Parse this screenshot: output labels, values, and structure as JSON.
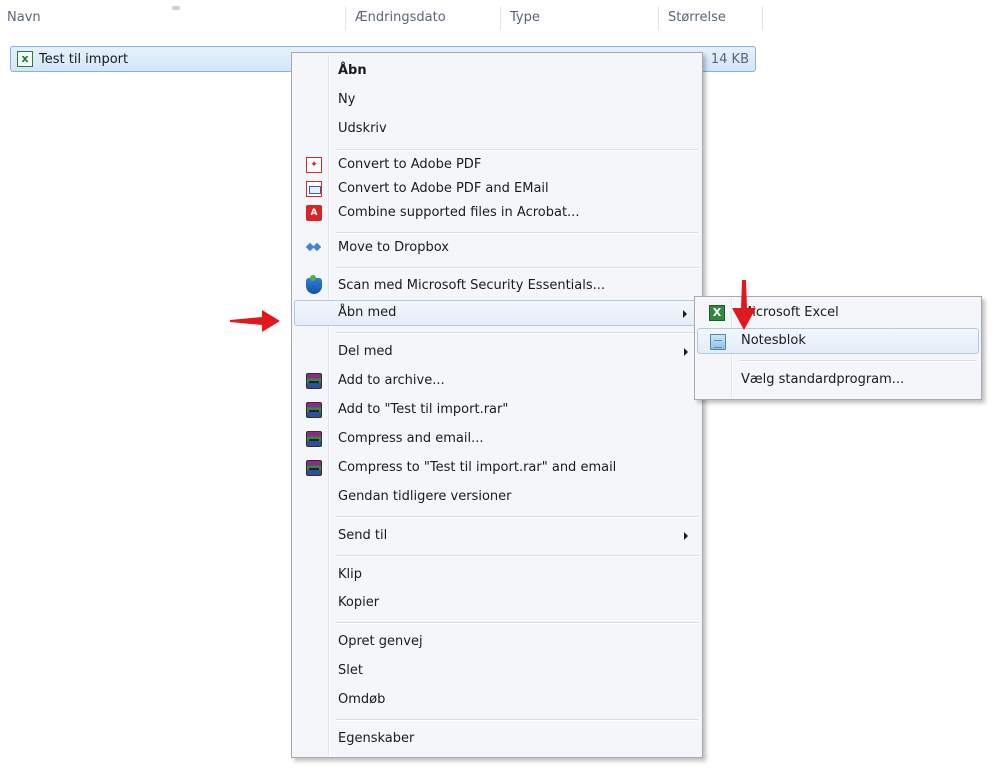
{
  "explorer": {
    "columns": {
      "name": "Navn",
      "modified": "Ændringsdato",
      "type": "Type",
      "size": "Størrelse"
    },
    "file": {
      "name": "Test til import",
      "size": "14 KB",
      "icon": "excel-file-icon"
    }
  },
  "context_menu": {
    "open": "Åbn",
    "new": "Ny",
    "print": "Udskriv",
    "convert_pdf": "Convert to Adobe PDF",
    "convert_pdf_email": "Convert to Adobe PDF and EMail",
    "combine_acrobat": "Combine supported files in Acrobat...",
    "move_dropbox": "Move to Dropbox",
    "scan_mse": "Scan med Microsoft Security Essentials...",
    "open_with": "Åbn med",
    "share_with": "Del med",
    "add_archive": "Add to archive...",
    "add_rar": "Add to \"Test til import.rar\"",
    "compress_email": "Compress and email...",
    "compress_rar_email": "Compress to \"Test til import.rar\" and email",
    "restore_versions": "Gendan tidligere versioner",
    "send_to": "Send til",
    "cut": "Klip",
    "copy": "Kopier",
    "create_shortcut": "Opret genvej",
    "delete": "Slet",
    "rename": "Omdøb",
    "properties": "Egenskaber"
  },
  "submenu": {
    "excel": "Microsoft Excel",
    "notepad": "Notesblok",
    "choose_default": "Vælg standardprogram..."
  },
  "colors": {
    "annotation_arrow": "#e0191e",
    "selection": "#d2e6fa",
    "menu_background": "#f4f6f9"
  }
}
